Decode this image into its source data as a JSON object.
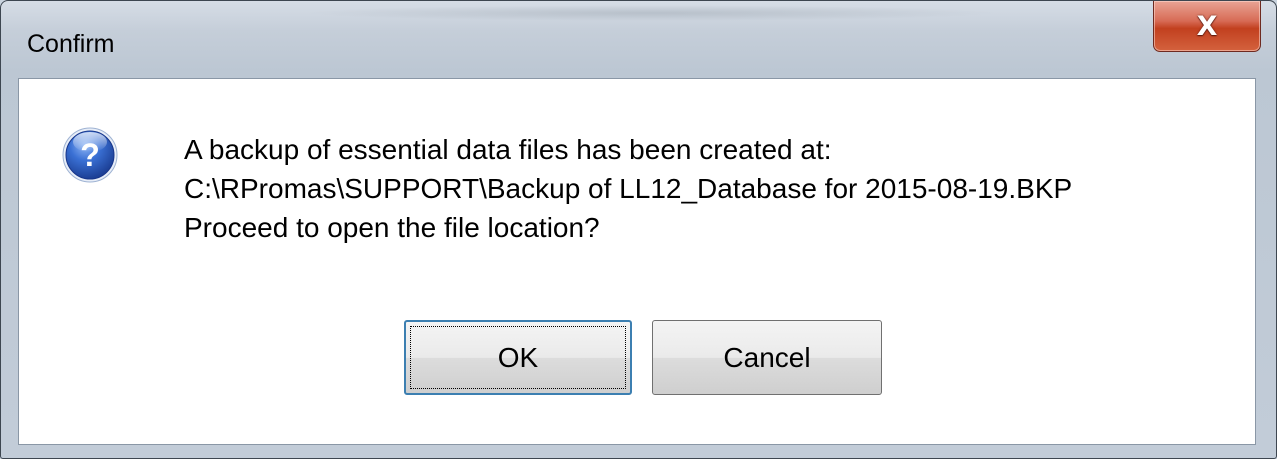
{
  "window": {
    "title": "Confirm",
    "close_glyph": "X"
  },
  "dialog": {
    "icon": "question-icon",
    "message_lines": [
      "A backup of essential data files has been created at:",
      "C:\\RPromas\\SUPPORT\\Backup of LL12_Database for 2015-08-19.BKP",
      "Proceed to open the file location?"
    ],
    "buttons": {
      "ok_label": "OK",
      "cancel_label": "Cancel"
    }
  },
  "colors": {
    "close_button": "#c2401f",
    "default_button_border": "#3c7fb1",
    "icon_blue": "#2a5fc0"
  }
}
